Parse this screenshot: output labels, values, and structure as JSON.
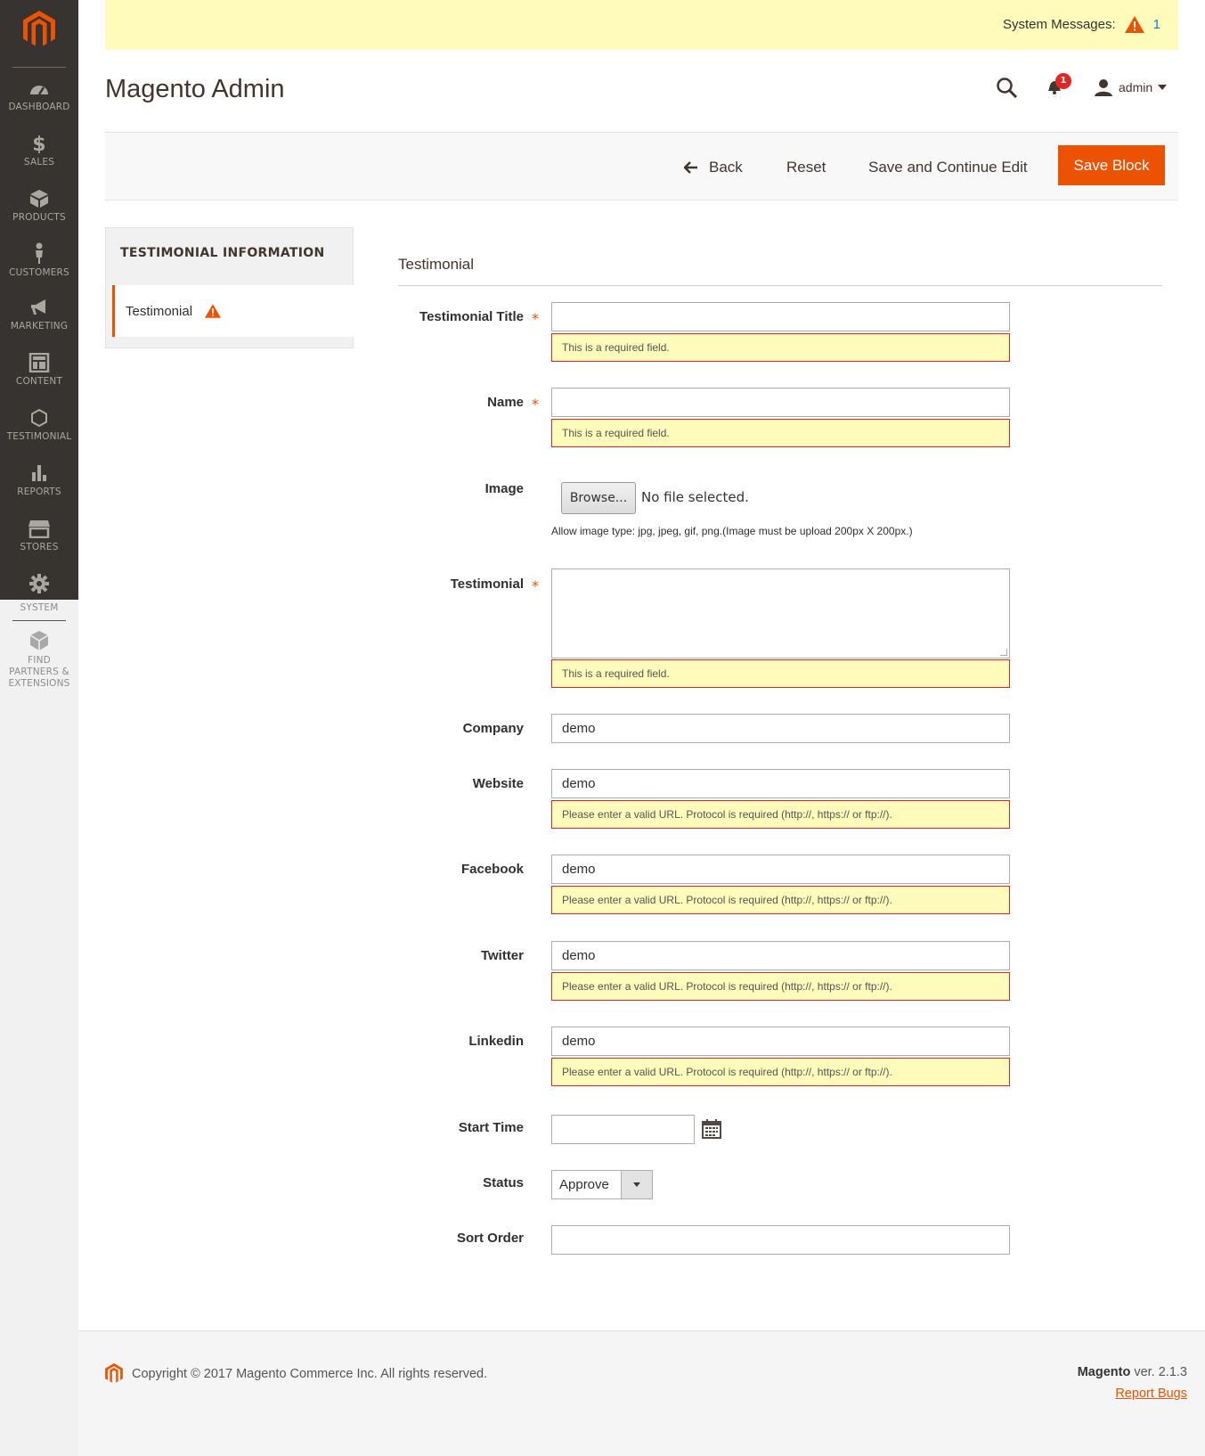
{
  "system_messages": {
    "label": "System Messages:",
    "count": "1"
  },
  "header": {
    "title": "Magento Admin",
    "notifications_count": "1",
    "user": "admin"
  },
  "sidebar": {
    "items": [
      {
        "label": "DASHBOARD",
        "icon": "dashboard-icon"
      },
      {
        "label": "SALES",
        "icon": "dollar-icon"
      },
      {
        "label": "PRODUCTS",
        "icon": "box-icon"
      },
      {
        "label": "CUSTOMERS",
        "icon": "person-icon"
      },
      {
        "label": "MARKETING",
        "icon": "megaphone-icon"
      },
      {
        "label": "CONTENT",
        "icon": "layout-icon"
      },
      {
        "label": "TESTIMONIAL",
        "icon": "hexagon-icon"
      },
      {
        "label": "REPORTS",
        "icon": "bar-chart-icon"
      },
      {
        "label": "STORES",
        "icon": "store-icon"
      },
      {
        "label": "SYSTEM",
        "icon": "gear-icon"
      }
    ],
    "extensions": [
      "FIND",
      "PARTNERS &",
      "EXTENSIONS"
    ]
  },
  "actions": {
    "back": "Back",
    "reset": "Reset",
    "save_continue": "Save and Continue Edit",
    "save": "Save Block"
  },
  "tabs": {
    "title": "TESTIMONIAL INFORMATION",
    "item": "Testimonial"
  },
  "form": {
    "section_title": "Testimonial",
    "testimonial_title": {
      "label": "Testimonial Title",
      "value": "",
      "error": "This is a required field."
    },
    "name": {
      "label": "Name",
      "value": "",
      "error": "This is a required field."
    },
    "image": {
      "label": "Image",
      "browse": "Browse...",
      "no_file": "No file selected.",
      "hint": "Allow image type: jpg, jpeg, gif, png.(Image must be upload 200px X 200px.)"
    },
    "testimonial": {
      "label": "Testimonial",
      "value": "",
      "error": "This is a required field."
    },
    "company": {
      "label": "Company",
      "value": "demo"
    },
    "website": {
      "label": "Website",
      "value": "demo",
      "error": "Please enter a valid URL. Protocol is required (http://, https:// or ftp://)."
    },
    "facebook": {
      "label": "Facebook",
      "value": "demo",
      "error": "Please enter a valid URL. Protocol is required (http://, https:// or ftp://)."
    },
    "twitter": {
      "label": "Twitter",
      "value": "demo",
      "error": "Please enter a valid URL. Protocol is required (http://, https:// or ftp://)."
    },
    "linkedin": {
      "label": "Linkedin",
      "value": "demo",
      "error": "Please enter a valid URL. Protocol is required (http://, https:// or ftp://)."
    },
    "start_time": {
      "label": "Start Time",
      "value": ""
    },
    "status": {
      "label": "Status",
      "value": "Approve"
    },
    "sort_order": {
      "label": "Sort Order",
      "value": ""
    },
    "required_mark": "*"
  },
  "footer": {
    "copyright": "Copyright © 2017 Magento Commerce Inc. All rights reserved.",
    "brand": "Magento",
    "version": "ver. 2.1.3",
    "report_bugs": "Report Bugs"
  },
  "colors": {
    "accent": "#eb5202",
    "sidebar": "#373330",
    "error_border": "#e22626",
    "notice_bg": "#fffbbb"
  }
}
